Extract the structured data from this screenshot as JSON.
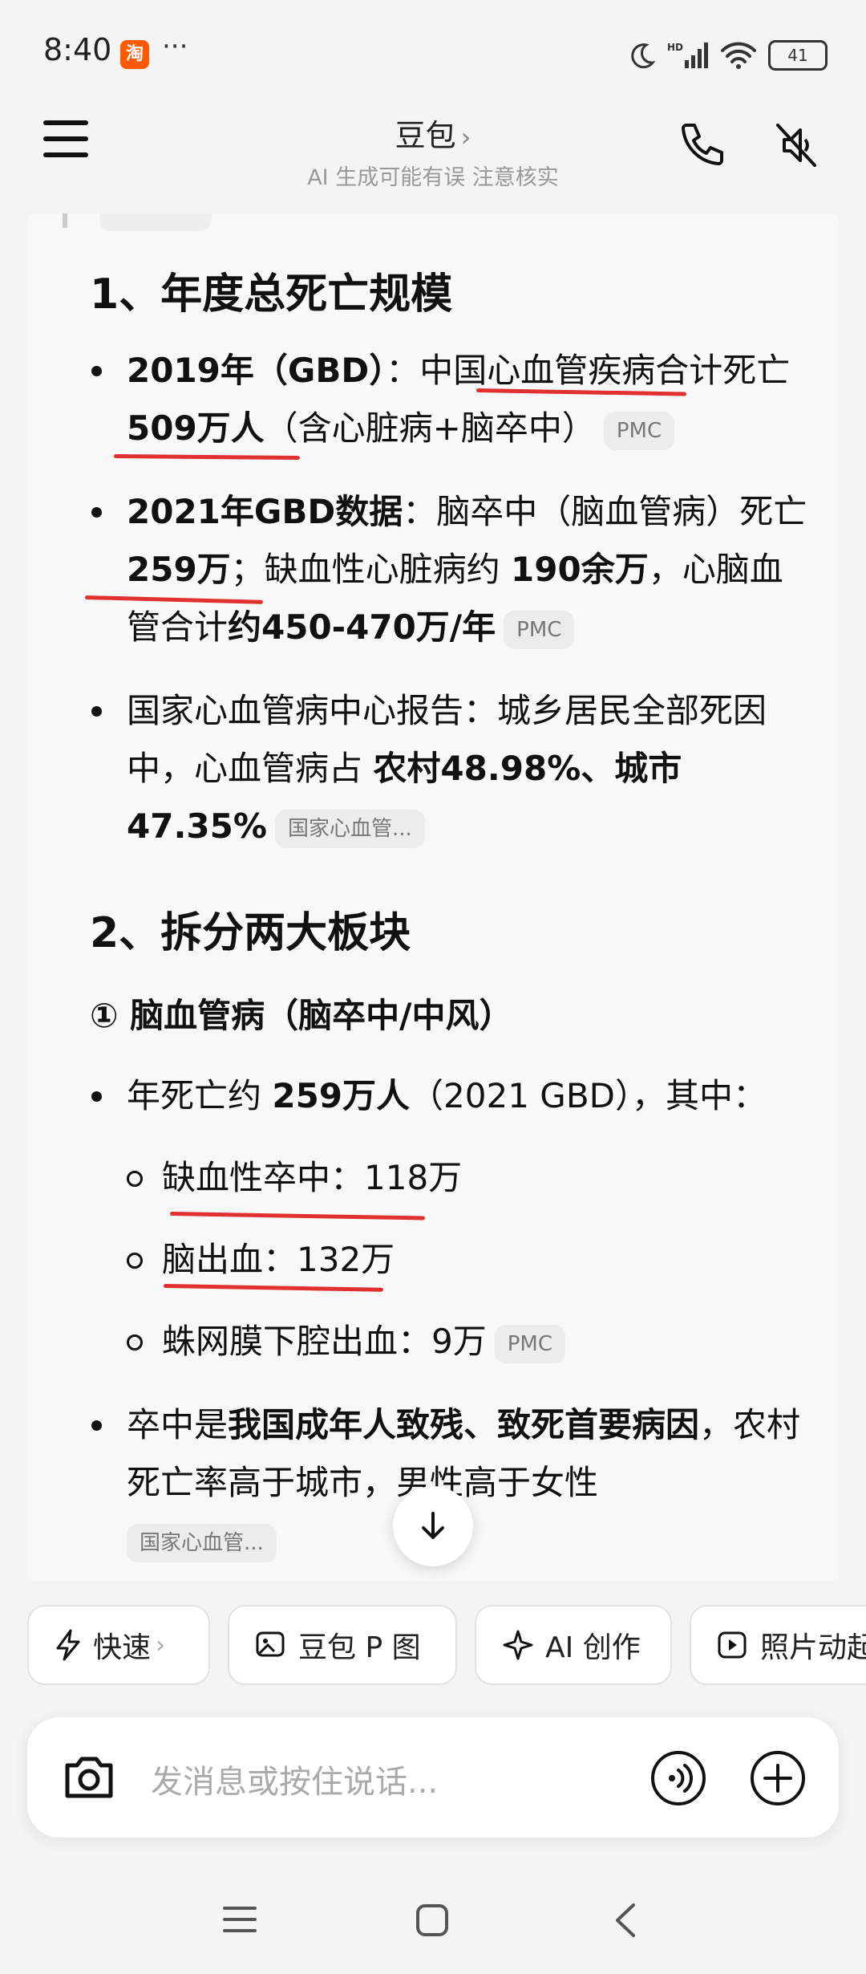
{
  "status": {
    "time": "8:40",
    "app_badge": "淘",
    "dots": "···",
    "network": "HD",
    "battery": "41"
  },
  "header": {
    "title": "豆包",
    "chevron": "›",
    "subtitle": "AI 生成可能有误 注意核实"
  },
  "section1": {
    "heading": "1、年度总死亡规模",
    "b1": {
      "t1": "2019年（GBD）",
      "t2": "：中国心血管疾病合计死亡",
      "t3": " 509万人",
      "t4": "（含心脏病+脑卒中）",
      "chip": "PMC"
    },
    "b2": {
      "t1": "2021年GBD数据",
      "t2": "：脑卒中（脑血管病）死亡",
      "t3": " 259万",
      "t4": "；缺血性心脏病约 ",
      "t5": "190余万",
      "t6": "，心脑血管合计",
      "t7": "约450-470万/年",
      "chip": "PMC"
    },
    "b3": {
      "t1": "国家心血管病中心报告：城乡居民全部死因中，心血管病占 ",
      "t2": "农村48.98%、城市47.35%",
      "chip": "国家心血管..."
    }
  },
  "section2": {
    "heading": "2、拆分两大板块",
    "sub_heading": "① 脑血管病（脑卒中/中风）",
    "b1": {
      "t1": "年死亡约 ",
      "t2": "259万人",
      "t3": "（2021 GBD），其中："
    },
    "s1": "缺血性卒中：118万",
    "s2": "脑出血：132万",
    "s3": {
      "text": "蛛网膜下腔出血：9万",
      "chip": "PMC"
    },
    "b2": {
      "t1": "卒中是",
      "t2": "我国成年人致残、致死首要病因",
      "t3": "，农村死亡率高于城市，男性高于女性",
      "chip": "国家心血管..."
    }
  },
  "quick_actions": [
    {
      "label": "快速",
      "chevron": "›"
    },
    {
      "label": "豆包 P 图"
    },
    {
      "label": "AI 创作"
    },
    {
      "label": "照片动起来"
    }
  ],
  "input": {
    "placeholder": "发消息或按住说话..."
  },
  "colors": {
    "annotation": "#e03030",
    "card_bg": "#f8f8f8",
    "page_bg": "#f4f4f4"
  }
}
